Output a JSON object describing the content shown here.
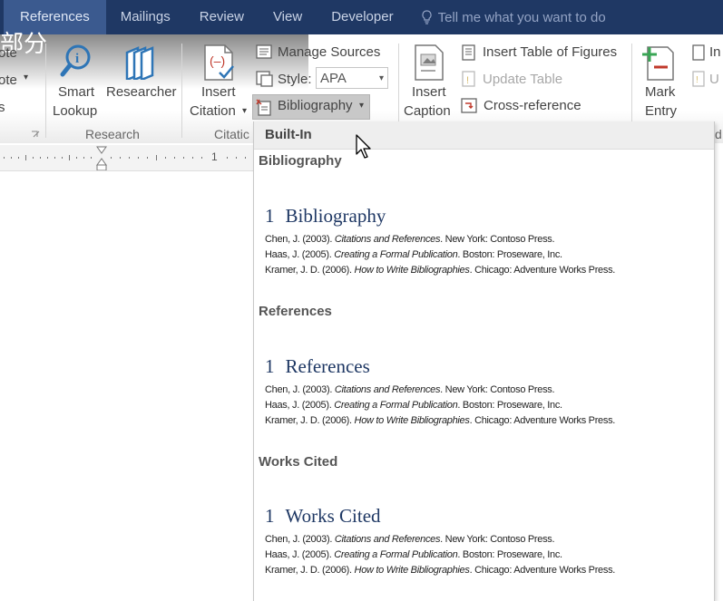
{
  "tabs": [
    {
      "label": "References",
      "active": true
    },
    {
      "label": "Mailings"
    },
    {
      "label": "Review"
    },
    {
      "label": "View"
    },
    {
      "label": "Developer"
    }
  ],
  "tell_me": "Tell me what you want to do",
  "cjk_text": "部分",
  "ribbon": {
    "left_partial": [
      "ote",
      "ote",
      "s"
    ],
    "research": {
      "smart_lookup": [
        "Smart",
        "Lookup"
      ],
      "researcher": "Researcher",
      "group_label": "Research"
    },
    "citations": {
      "insert_citation": [
        "Insert",
        "Citation"
      ],
      "manage_sources": "Manage Sources",
      "style_label": "Style:",
      "style_value": "APA",
      "bibliography": "Bibliography",
      "group_label": "Citatic"
    },
    "captions": {
      "insert_caption": [
        "Insert",
        "Caption"
      ],
      "insert_table_of_figures": "Insert Table of Figures",
      "update_table": "Update Table",
      "cross_reference": "Cross-reference"
    },
    "index": {
      "mark_entry": [
        "Mark",
        "Entry"
      ],
      "partial": [
        "In",
        "U"
      ],
      "group_partial": "d"
    }
  },
  "ruler": {
    "mark": "1"
  },
  "gallery": {
    "header": "Built-In",
    "sections": [
      {
        "label": "Bibliography",
        "number": "1",
        "heading": "Bibliography",
        "entries": [
          {
            "pre": "Chen, J. (2003). ",
            "title": "Citations and References",
            "post": ". New York: Contoso Press."
          },
          {
            "pre": "Haas, J. (2005). ",
            "title": "Creating a Formal Publication",
            "post": ". Boston: Proseware, Inc."
          },
          {
            "pre": "Kramer, J. D. (2006). ",
            "title": "How to Write Bibliographies",
            "post": ". Chicago: Adventure Works Press."
          }
        ]
      },
      {
        "label": "References",
        "number": "1",
        "heading": "References",
        "entries": [
          {
            "pre": "Chen, J. (2003). ",
            "title": "Citations and References",
            "post": ". New York: Contoso Press."
          },
          {
            "pre": "Haas, J. (2005). ",
            "title": "Creating a Formal Publication",
            "post": ". Boston: Proseware, Inc."
          },
          {
            "pre": "Kramer, J. D. (2006). ",
            "title": "How to Write Bibliographies",
            "post": ". Chicago: Adventure Works Press."
          }
        ]
      },
      {
        "label": "Works Cited",
        "number": "1",
        "heading": "Works Cited",
        "entries": [
          {
            "pre": "Chen, J. (2003). ",
            "title": "Citations and References",
            "post": ". New York: Contoso Press."
          },
          {
            "pre": "Haas, J. (2005). ",
            "title": "Creating a Formal Publication",
            "post": ". Boston: Proseware, Inc."
          },
          {
            "pre": "Kramer, J. D. (2006). ",
            "title": "How to Write Bibliographies",
            "post": ". Chicago: Adventure Works Press."
          }
        ]
      }
    ]
  },
  "colors": {
    "titlebar": "#1f3864",
    "active_tab": "#3b5a8f",
    "heading_blue": "#1f3864"
  },
  "icons": [
    "lightbulb-icon",
    "smart-lookup-icon",
    "researcher-icon",
    "insert-citation-icon",
    "manage-sources-icon",
    "style-icon",
    "bibliography-icon",
    "insert-caption-icon",
    "table-of-figures-icon",
    "update-table-icon",
    "cross-reference-icon",
    "mark-entry-icon",
    "dialog-launcher-icon",
    "mouse-cursor-icon"
  ]
}
